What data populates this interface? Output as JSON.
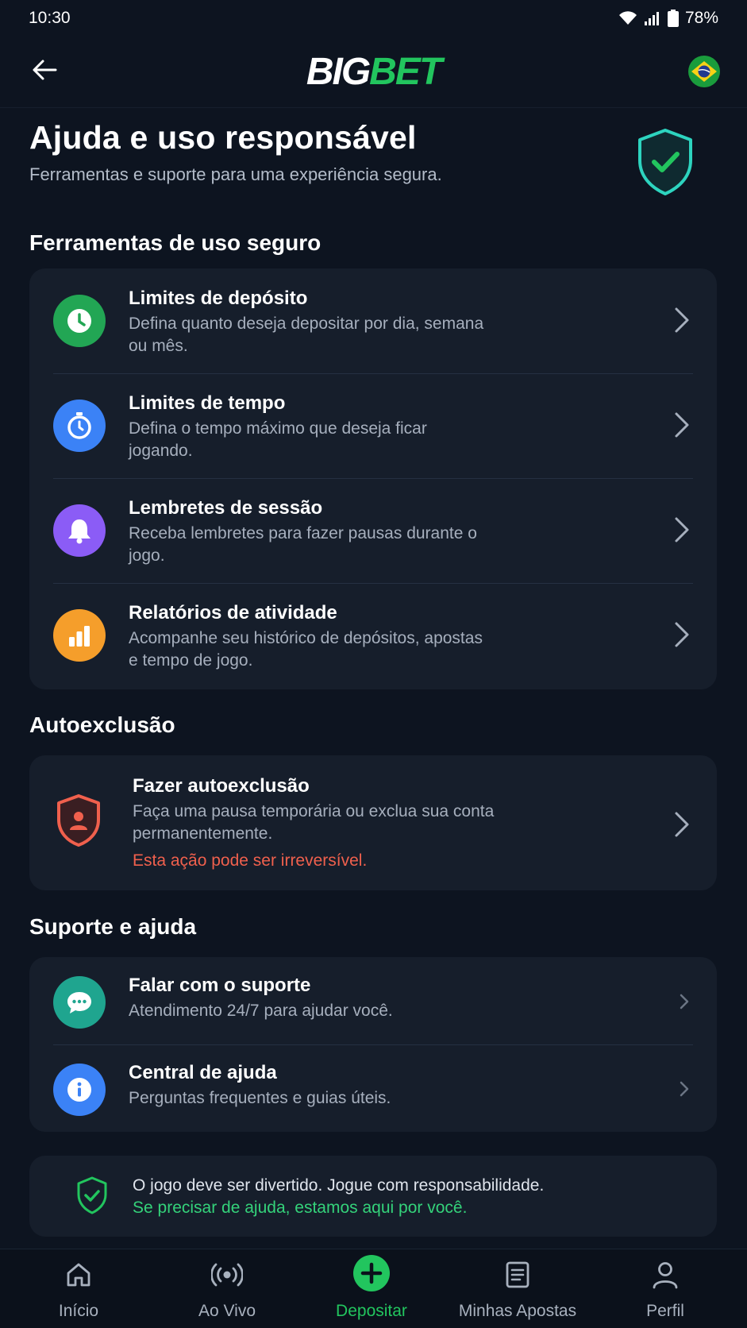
{
  "status_bar": {
    "time": "10:30",
    "battery": "78%"
  },
  "header": {
    "logo_big": "BIG",
    "logo_bet": "BET"
  },
  "hero": {
    "title": "Ajuda e uso responsável",
    "subtitle": "Ferramentas e suporte para uma experiência segura."
  },
  "safe_tools": {
    "title": "Ferramentas de uso seguro",
    "items": [
      {
        "title": "Limites de depósito",
        "desc": "Defina quanto deseja depositar por dia, semana ou mês.",
        "icon": "clock-icon",
        "color": "#22a654"
      },
      {
        "title": "Limites de tempo",
        "desc": "Defina o tempo máximo que deseja ficar jogando.",
        "icon": "stopwatch-icon",
        "color": "#3b82f6"
      },
      {
        "title": "Lembretes de sessão",
        "desc": "Receba lembretes para fazer pausas durante o jogo.",
        "icon": "bell-icon",
        "color": "#8b5cf6"
      },
      {
        "title": "Relatórios de atividade",
        "desc": "Acompanhe seu histórico de depósitos, apostas e tempo de jogo.",
        "icon": "bar-chart-icon",
        "color": "#f59e2b"
      }
    ]
  },
  "self_exclusion": {
    "title": "Autoexclusão",
    "item": {
      "title": "Fazer autoexclusão",
      "desc": "Faça uma pausa temporária ou exclua sua conta permanentemente.",
      "warning": "Esta ação pode ser irreversível.",
      "icon": "user-shield-icon"
    }
  },
  "support": {
    "title": "Suporte e ajuda",
    "items": [
      {
        "title": "Falar com o suporte",
        "desc": "Atendimento 24/7 para ajudar você.",
        "icon": "chat-icon",
        "color": "#1fa58f"
      },
      {
        "title": "Central de ajuda",
        "desc": "Perguntas frequentes e guias úteis.",
        "icon": "info-icon",
        "color": "#3b82f6"
      }
    ]
  },
  "footer_note": {
    "line1": "O jogo deve ser divertido. Jogue com responsabilidade.",
    "line2": "Se precisar de ajuda, estamos aqui por você."
  },
  "bottom_nav": [
    {
      "label": "Início",
      "icon": "home-icon"
    },
    {
      "label": "Ao Vivo",
      "icon": "live-icon"
    },
    {
      "label": "Depositar",
      "icon": "plus-circle-icon",
      "active": true
    },
    {
      "label": "Minhas Apostas",
      "icon": "bets-list-icon"
    },
    {
      "label": "Perfil",
      "icon": "profile-icon"
    }
  ],
  "colors": {
    "accent": "#22c55e",
    "background": "#0d1420",
    "card": "#161e2b",
    "danger": "#f0604d"
  }
}
